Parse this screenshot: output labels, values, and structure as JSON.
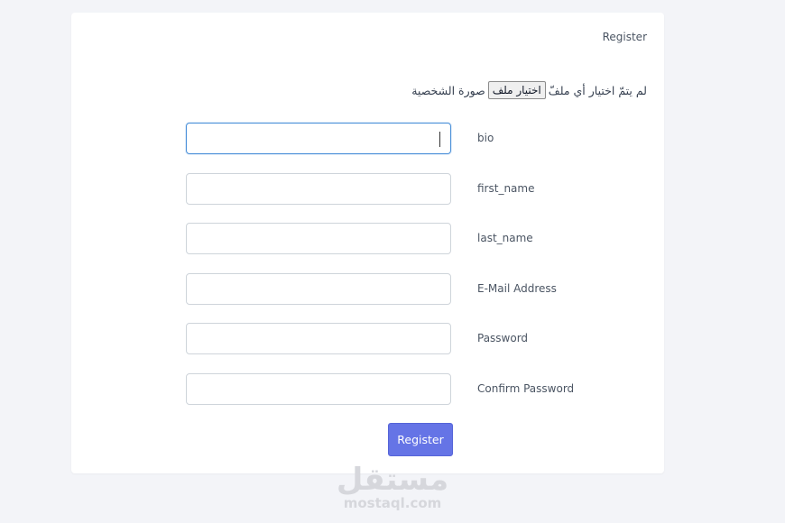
{
  "card": {
    "title": "Register"
  },
  "profile_photo": {
    "label": "صورة الشخصية",
    "choose_file_button": "اختيار ملف",
    "no_file_text": "لم يتمّ اختيار أي ملفّ"
  },
  "fields": [
    {
      "label": "bio",
      "value": "",
      "focused": true
    },
    {
      "label": "first_name",
      "value": ""
    },
    {
      "label": "last_name",
      "value": ""
    },
    {
      "label": "E-Mail Address",
      "value": ""
    },
    {
      "label": "Password",
      "value": ""
    },
    {
      "label": "Confirm Password",
      "value": ""
    }
  ],
  "submit": {
    "label": "Register"
  },
  "watermark": {
    "arabic": "مستقل",
    "latin": "mostaql.com"
  },
  "colors": {
    "page_background": "#f3f4f8",
    "card_background": "#ffffff",
    "primary_button": "#6574e6",
    "focus_border": "#4a90d9",
    "input_border": "#ced4da"
  }
}
